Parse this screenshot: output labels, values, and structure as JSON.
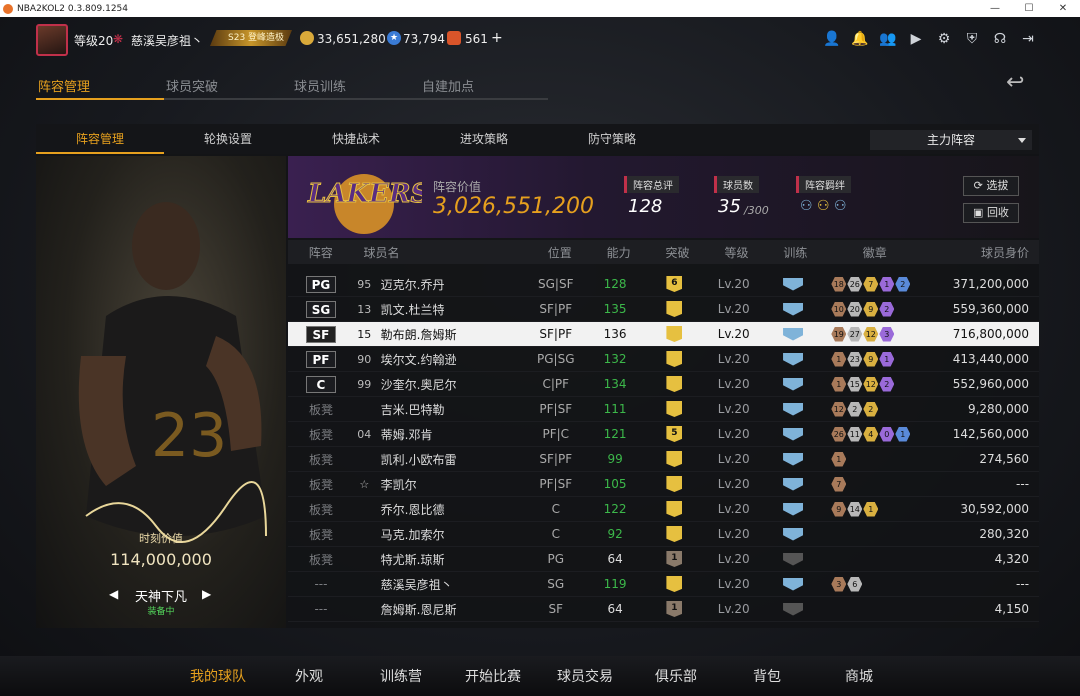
{
  "window": {
    "title": "NBA2KOL2 0.3.809.1254",
    "controls": [
      "—",
      "☐",
      "✕"
    ]
  },
  "topbar": {
    "level": "等级20",
    "username": "慈溪吴彦祖丶",
    "tier": "S23 登峰造极",
    "coins": "33,651,280",
    "stars": "73,794",
    "tickets": "561",
    "plus": "+"
  },
  "tabs": [
    "阵容管理",
    "球员突破",
    "球员训练",
    "自建加点"
  ],
  "subtabs": [
    "阵容管理",
    "轮换设置",
    "快捷战术",
    "进攻策略",
    "防守策略"
  ],
  "lineup_select": "主力阵容",
  "card": {
    "value_label": "时刻价值",
    "value": "114,000,000",
    "nickname": "天神下凡",
    "status": "装备中"
  },
  "banner": {
    "team_value_label": "阵容价值",
    "team_value": "3,026,551,200",
    "rating_label": "阵容总评",
    "rating": "128",
    "count_label": "球员数",
    "count": "35",
    "count_max": "/300",
    "bond_label": "阵容羁绊",
    "btn_select": "选拔",
    "btn_recycle": "回收"
  },
  "columns": [
    "阵容",
    "球员名",
    "位置",
    "能力",
    "突破",
    "等级",
    "训练",
    "徽章",
    "球员身价"
  ],
  "rows": [
    {
      "slot": "PG",
      "num": "95",
      "name": "迈克尔.乔丹",
      "pos": "SG|SF",
      "ability": "128",
      "green": true,
      "break": "6",
      "lv": "Lv.20",
      "train": true,
      "badges": [
        "18",
        "26",
        "7",
        "1",
        "2"
      ],
      "value": "371,200,000"
    },
    {
      "slot": "SG",
      "num": "13",
      "name": "凯文.杜兰特",
      "pos": "SF|PF",
      "ability": "135",
      "green": true,
      "break": "",
      "lv": "Lv.20",
      "train": true,
      "badges": [
        "10",
        "20",
        "9",
        "2"
      ],
      "value": "559,360,000"
    },
    {
      "slot": "SF",
      "num": "15",
      "name": "勒布朗.詹姆斯",
      "pos": "SF|PF",
      "ability": "136",
      "green": false,
      "break": "",
      "lv": "Lv.20",
      "train": true,
      "badges": [
        "19",
        "27",
        "12",
        "3"
      ],
      "value": "716,800,000",
      "selected": true
    },
    {
      "slot": "PF",
      "num": "90",
      "name": "埃尔文.约翰逊",
      "pos": "PG|SG",
      "ability": "132",
      "green": true,
      "break": "",
      "lv": "Lv.20",
      "train": true,
      "badges": [
        "1",
        "23",
        "9",
        "1"
      ],
      "value": "413,440,000"
    },
    {
      "slot": "C",
      "num": "99",
      "name": "沙奎尔.奥尼尔",
      "pos": "C|PF",
      "ability": "134",
      "green": true,
      "break": "",
      "lv": "Lv.20",
      "train": true,
      "badges": [
        "1",
        "15",
        "12",
        "2"
      ],
      "value": "552,960,000"
    },
    {
      "slot": "板凳",
      "num": "",
      "name": "吉米.巴特勒",
      "pos": "PF|SF",
      "ability": "111",
      "green": true,
      "break": "",
      "lv": "Lv.20",
      "train": true,
      "badges": [
        "12",
        "2",
        "2"
      ],
      "value": "9,280,000"
    },
    {
      "slot": "板凳",
      "num": "04",
      "name": "蒂姆.邓肯",
      "pos": "PF|C",
      "ability": "121",
      "green": true,
      "break": "5",
      "lv": "Lv.20",
      "train": true,
      "badges": [
        "26",
        "11",
        "4",
        "0",
        "1"
      ],
      "value": "142,560,000"
    },
    {
      "slot": "板凳",
      "num": "",
      "name": "凯利.小欧布雷",
      "pos": "SF|PF",
      "ability": "99",
      "green": true,
      "break": "",
      "lv": "Lv.20",
      "train": true,
      "badges": [
        "1"
      ],
      "value": "274,560"
    },
    {
      "slot": "板凳",
      "num": "☆",
      "name": "李凯尔",
      "pos": "PF|SF",
      "ability": "105",
      "green": true,
      "break": "",
      "lv": "Lv.20",
      "train": true,
      "badges": [
        "7"
      ],
      "value": "---"
    },
    {
      "slot": "板凳",
      "num": "",
      "name": "乔尔.恩比德",
      "pos": "C",
      "ability": "122",
      "green": true,
      "break": "",
      "lv": "Lv.20",
      "train": true,
      "badges": [
        "9",
        "14",
        "1"
      ],
      "value": "30,592,000"
    },
    {
      "slot": "板凳",
      "num": "",
      "name": "马克.加索尔",
      "pos": "C",
      "ability": "92",
      "green": true,
      "break": "",
      "lv": "Lv.20",
      "train": true,
      "badges": [],
      "value": "280,320"
    },
    {
      "slot": "板凳",
      "num": "",
      "name": "特尤斯.琼斯",
      "pos": "PG",
      "ability": "64",
      "green": false,
      "break": "1",
      "dim": true,
      "lv": "Lv.20",
      "train": false,
      "badges": [],
      "value": "4,320"
    },
    {
      "slot": "---",
      "num": "",
      "name": "慈溪吴彦祖丶",
      "pos": "SG",
      "ability": "119",
      "green": true,
      "break": "",
      "lv": "Lv.20",
      "train": true,
      "badges": [
        "3",
        "6"
      ],
      "value": "---"
    },
    {
      "slot": "---",
      "num": "",
      "name": "詹姆斯.恩尼斯",
      "pos": "SF",
      "ability": "64",
      "green": false,
      "break": "1",
      "dim": true,
      "lv": "Lv.20",
      "train": false,
      "badges": [],
      "value": "4,150"
    }
  ],
  "bottom_nav": [
    "我的球队",
    "外观",
    "训练营",
    "开始比赛",
    "球员交易",
    "俱乐部",
    "背包",
    "商城"
  ],
  "colors": {
    "accent": "#e6a01e",
    "green": "#3cb84a"
  }
}
